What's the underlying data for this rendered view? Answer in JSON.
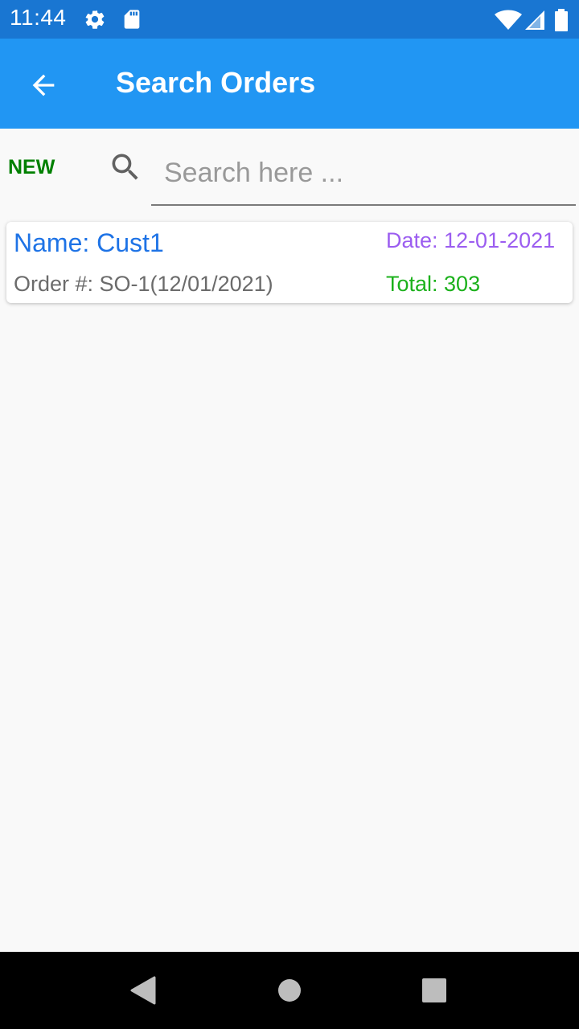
{
  "status_bar": {
    "time": "11:44",
    "icons": [
      "gear-icon",
      "sd-card-icon",
      "wifi-icon",
      "signal-icon",
      "battery-icon"
    ]
  },
  "app_bar": {
    "title": "Search Orders",
    "back_icon": "arrow-left-icon"
  },
  "toolbar": {
    "new_label": "NEW",
    "search_placeholder": "Search here ...",
    "search_value": ""
  },
  "orders": [
    {
      "name": "Name: Cust1",
      "date": "Date: 12-01-2021",
      "order_number": "Order #: SO-1(12/01/2021)",
      "total": "Total: 303"
    }
  ],
  "nav_bar": {
    "icons": [
      "back-triangle-icon",
      "home-circle-icon",
      "recents-square-icon"
    ]
  },
  "colors": {
    "status_bar": "#1976d2",
    "app_bar": "#2196f3",
    "new_label": "#008000",
    "name": "#1e73e6",
    "date": "#9b5df0",
    "total": "#1bb11b"
  }
}
